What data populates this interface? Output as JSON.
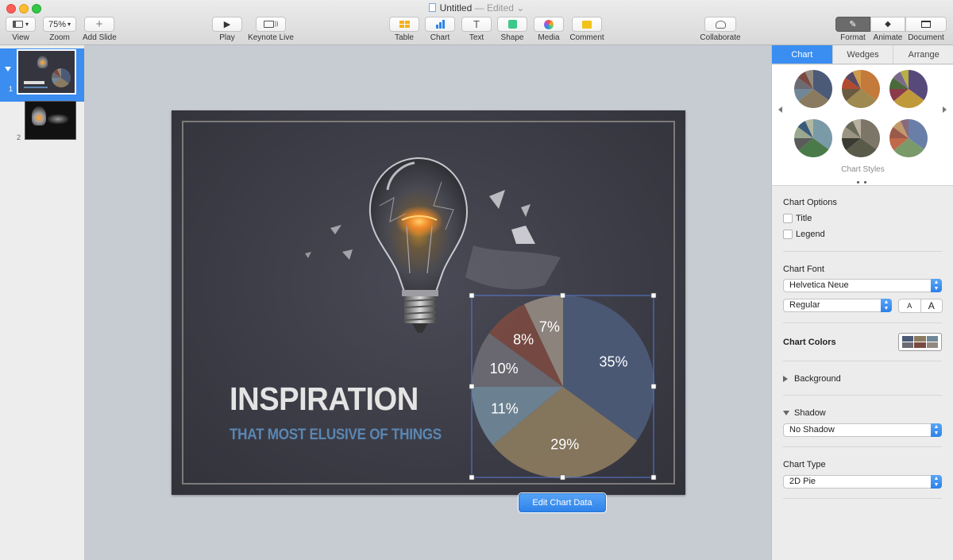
{
  "window": {
    "title": "Untitled",
    "status": "— Edited"
  },
  "toolbar": {
    "view": "View",
    "zoom_value": "75%",
    "zoom": "Zoom",
    "add_slide": "Add Slide",
    "play": "Play",
    "keynote_live": "Keynote Live",
    "table": "Table",
    "chart": "Chart",
    "text": "Text",
    "shape": "Shape",
    "media": "Media",
    "comment": "Comment",
    "collaborate": "Collaborate",
    "format": "Format",
    "animate": "Animate",
    "document": "Document"
  },
  "navigator": {
    "slides": [
      {
        "number": "1"
      },
      {
        "number": "2"
      }
    ]
  },
  "slide": {
    "title": "INSPIRATION",
    "subtitle": "THAT MOST ELUSIVE OF THINGS",
    "edit_chart_data": "Edit Chart Data"
  },
  "chart_data": {
    "type": "pie",
    "values": [
      35,
      29,
      11,
      10,
      8,
      7
    ],
    "labels": [
      "35%",
      "29%",
      "11%",
      "10%",
      "8%",
      "7%"
    ],
    "colors": [
      "#4b5a77",
      "#8a7a5f",
      "#6f8797",
      "#6d6b72",
      "#7a4a42",
      "#928a80"
    ]
  },
  "inspector": {
    "tabs": [
      "Chart",
      "Wedges",
      "Arrange"
    ],
    "chart_styles_label": "Chart Styles",
    "chart_styles": [
      [
        "#4b5a77",
        "#8a7a5f",
        "#6f8797",
        "#6d6b72",
        "#7a4a42",
        "#928a80"
      ],
      [
        "#c47a3a",
        "#9e8a50",
        "#6a5a40",
        "#b24a2e",
        "#5a4a62",
        "#d19a4a"
      ],
      [
        "#574a7a",
        "#c09a3a",
        "#8a3a4a",
        "#4a6a3a",
        "#7a6a8a",
        "#b5b048"
      ],
      [
        "#7a9aa8",
        "#4a7a4a",
        "#5a5a5a",
        "#9aa890",
        "#3a5a7a",
        "#b0b8a0"
      ],
      [
        "#7d7668",
        "#5a5a4a",
        "#3a3a32",
        "#9a9482",
        "#6a6a5a",
        "#b8b0a0"
      ],
      [
        "#6a7fa8",
        "#7a9a6a",
        "#c06a4a",
        "#9a5a4a",
        "#c09a6a",
        "#8a6a7a"
      ]
    ],
    "chart_options": "Chart Options",
    "title_option": "Title",
    "legend_option": "Legend",
    "chart_font": "Chart Font",
    "font_name": "Helvetica Neue",
    "font_style": "Regular",
    "font_smaller": "A",
    "font_larger": "A",
    "chart_colors": "Chart Colors",
    "chart_colors_swatch": [
      "#4b5a77",
      "#8a7a5f",
      "#6f8797",
      "#6d6b72",
      "#7a4a42",
      "#928a80"
    ],
    "background": "Background",
    "shadow": "Shadow",
    "shadow_value": "No Shadow",
    "chart_type": "Chart Type",
    "chart_type_value": "2D Pie"
  }
}
